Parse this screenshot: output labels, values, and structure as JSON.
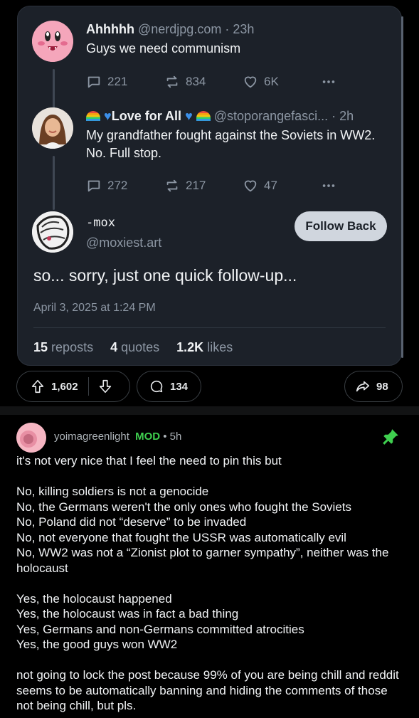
{
  "thread": {
    "posts": [
      {
        "display_name": "Ahhhhh",
        "handle": "@nerdjpg.com",
        "time": "23h",
        "text": "Guys we need communism",
        "replies": "221",
        "reposts": "834",
        "likes": "6K"
      },
      {
        "display_name": "Love for All",
        "handle": "@stoporangefasci...",
        "time": "2h",
        "text": "My grandfather fought against the Soviets in WW2. No. Full stop.",
        "replies": "272",
        "reposts": "217",
        "likes": "47"
      }
    ],
    "main": {
      "display_name": "-mox",
      "handle": "@moxiest.art",
      "follow_label": "Follow Back",
      "text": "so... sorry, just one quick follow-up...",
      "date": "April 3, 2025 at 1:24 PM",
      "reposts_count": "15",
      "reposts_label": "reposts",
      "quotes_count": "4",
      "quotes_label": "quotes",
      "likes_count": "1.2K",
      "likes_label": "likes"
    },
    "dot": "·"
  },
  "reddit": {
    "score": "1,602",
    "comments": "134",
    "shares": "98"
  },
  "comment": {
    "author": "yoimagreenlight",
    "badge": "MOD",
    "time": "• 5h",
    "paragraphs": [
      [
        "it's not very nice that I feel the need to pin this but"
      ],
      [
        "No, killing soldiers is not a genocide",
        "No, the Germans weren't the only ones who fought the Soviets",
        "No, Poland did not “deserve” to be invaded",
        "No, not everyone that fought the USSR was automatically evil",
        "No, WW2 was not a “Zionist plot to garner sympathy”, neither was the holocaust"
      ],
      [
        "Yes, the holocaust happened",
        "Yes, the holocaust was in fact a bad thing",
        "Yes, Germans and non-Germans committed atrocities",
        "Yes, the good guys won WW2"
      ],
      [
        "not going to lock the post because 99% of you are being chill and reddit seems to be automatically banning and hiding the comments of those not being chill, but pls."
      ]
    ]
  },
  "colors": {
    "card_bg": "#1c2129",
    "muted": "#8c96a3",
    "mod_green": "#3fcf4f",
    "follow_bg": "#d0d6de"
  }
}
